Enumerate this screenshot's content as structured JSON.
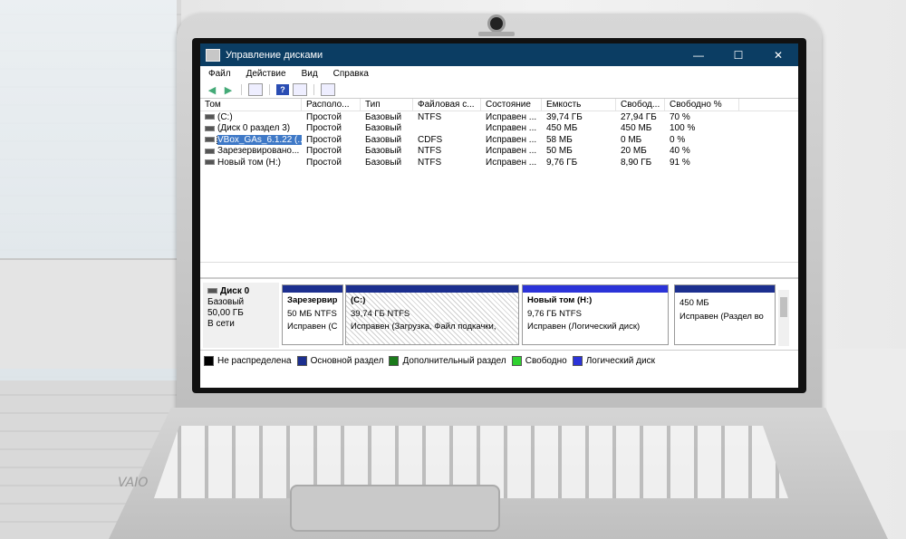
{
  "window": {
    "title": "Управление дисками",
    "controls": {
      "minimize": "—",
      "maximize": "☐",
      "close": "✕"
    }
  },
  "menu": [
    "Файл",
    "Действие",
    "Вид",
    "Справка"
  ],
  "toolbar": {
    "icons": [
      "back-arrow-icon",
      "forward-arrow-icon",
      "panel-icon",
      "help-icon",
      "console-icon",
      "properties-icon"
    ],
    "help_label": "?"
  },
  "volumes": {
    "columns": [
      "Том",
      "Располо...",
      "Тип",
      "Файловая с...",
      "Состояние",
      "Емкость",
      "Свобод...",
      "Свободно %"
    ],
    "rows": [
      {
        "tom": "(C:)",
        "layout": "Простой",
        "type": "Базовый",
        "fs": "NTFS",
        "status": "Исправен ...",
        "capacity": "39,74 ГБ",
        "free": "27,94 ГБ",
        "free_pct": "70 %"
      },
      {
        "tom": "(Диск 0 раздел 3)",
        "layout": "Простой",
        "type": "Базовый",
        "fs": "",
        "status": "Исправен ...",
        "capacity": "450 МБ",
        "free": "450 МБ",
        "free_pct": "100 %"
      },
      {
        "tom": "VBox_GAs_6.1.22 (...",
        "layout": "Простой",
        "type": "Базовый",
        "fs": "CDFS",
        "status": "Исправен ...",
        "capacity": "58 МБ",
        "free": "0 МБ",
        "free_pct": "0 %"
      },
      {
        "tom": "Зарезервировано...",
        "layout": "Простой",
        "type": "Базовый",
        "fs": "NTFS",
        "status": "Исправен ...",
        "capacity": "50 МБ",
        "free": "20 МБ",
        "free_pct": "40 %"
      },
      {
        "tom": "Новый том (H:)",
        "layout": "Простой",
        "type": "Базовый",
        "fs": "NTFS",
        "status": "Исправен ...",
        "capacity": "9,76 ГБ",
        "free": "8,90 ГБ",
        "free_pct": "91 %"
      }
    ]
  },
  "disk": {
    "name": "Диск 0",
    "type": "Базовый",
    "size": "50,00 ГБ",
    "state": "В сети",
    "partitions": [
      {
        "name": "Зарезервир",
        "size": "50 МБ NTFS",
        "status": "Исправен (С"
      },
      {
        "name": "(C:)",
        "size": "39,74 ГБ NTFS",
        "status": "Исправен (Загрузка, Файл подкачки,"
      },
      {
        "name": "Новый том  (H:)",
        "size": "9,76 ГБ NTFS",
        "status": "Исправен (Логический диск)"
      },
      {
        "name": "",
        "size": "450 МБ",
        "status": "Исправен (Раздел во"
      }
    ]
  },
  "legend": [
    {
      "label": "Не распределена",
      "color": "#000000"
    },
    {
      "label": "Основной раздел",
      "color": "#1c2f8f"
    },
    {
      "label": "Дополнительный раздел",
      "color": "#1a7a1a"
    },
    {
      "label": "Свободно",
      "color": "#2fd12f"
    },
    {
      "label": "Логический диск",
      "color": "#2b33d8"
    }
  ]
}
